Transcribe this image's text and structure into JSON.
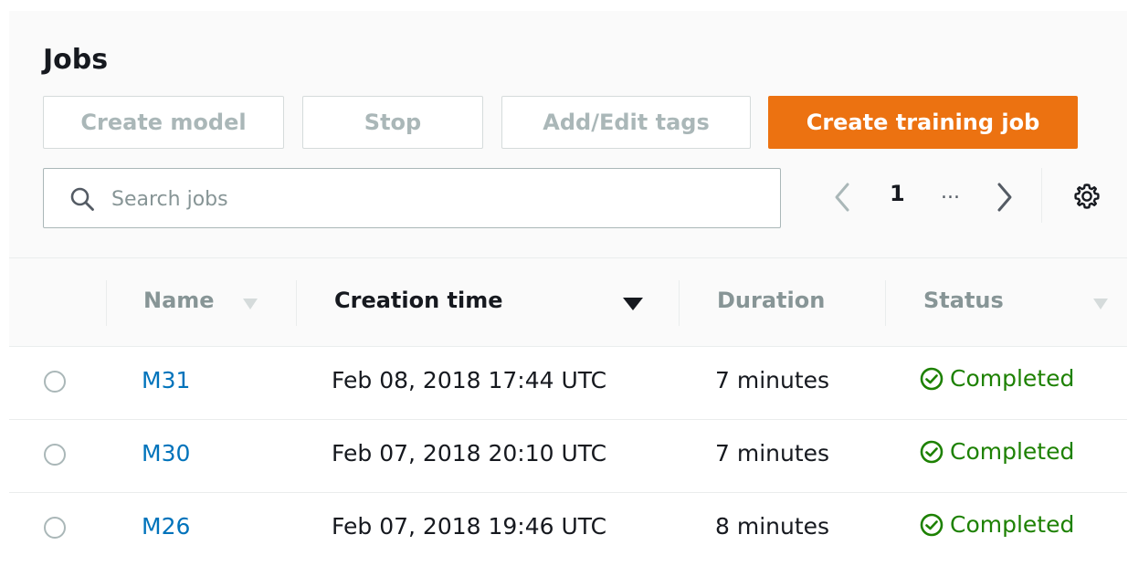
{
  "page": {
    "title": "Jobs"
  },
  "toolbar": {
    "create_model_label": "Create model",
    "stop_label": "Stop",
    "tags_label": "Add/Edit tags",
    "create_training_job_label": "Create training job"
  },
  "search": {
    "placeholder": "Search jobs",
    "value": ""
  },
  "pagination": {
    "current_page": "1",
    "ellipsis": "..."
  },
  "table": {
    "columns": [
      {
        "label": "Name",
        "sortable": true,
        "sorted": false
      },
      {
        "label": "Creation time",
        "sortable": true,
        "sorted": true,
        "direction": "descending"
      },
      {
        "label": "Duration",
        "sortable": false
      },
      {
        "label": "Status",
        "sortable": true,
        "sorted": false
      }
    ],
    "rows": [
      {
        "name": "M31",
        "creation_time": "Feb 08, 2018 17:44 UTC",
        "duration": "7 minutes",
        "status": "Completed"
      },
      {
        "name": "M30",
        "creation_time": "Feb 07, 2018 20:10 UTC",
        "duration": "7 minutes",
        "status": "Completed"
      },
      {
        "name": "M26",
        "creation_time": "Feb 07, 2018 19:46 UTC",
        "duration": "8 minutes",
        "status": "Completed"
      }
    ]
  },
  "colors": {
    "primary_button": "#ec7211",
    "link": "#0073bb",
    "status_success": "#1d8102",
    "disabled_text": "#aab7b8"
  },
  "icons": {
    "search": "search-icon",
    "prev": "chevron-left-icon",
    "next": "chevron-right-icon",
    "settings": "gear-icon",
    "status_completed": "check-circle-icon",
    "sort_desc": "caret-down-icon"
  }
}
